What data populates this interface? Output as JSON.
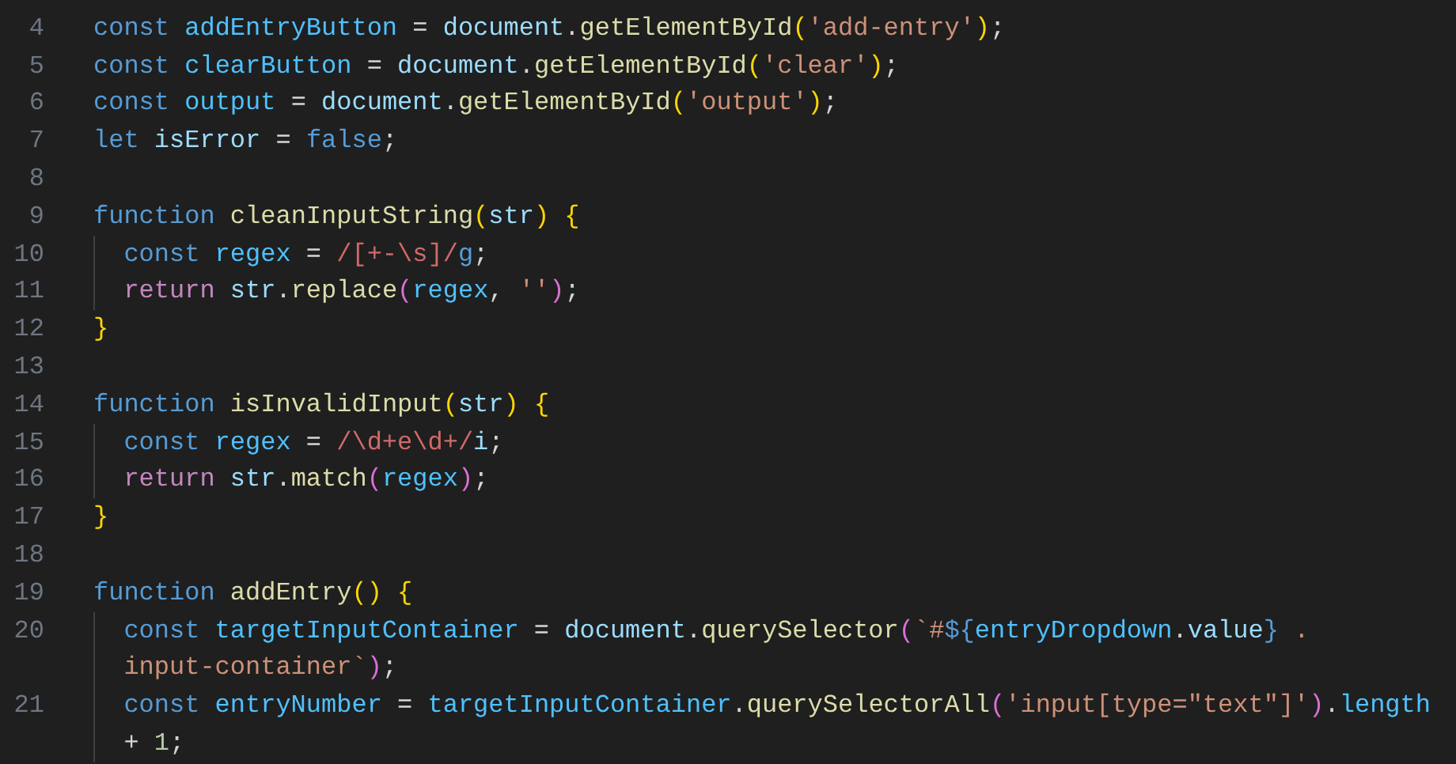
{
  "editor": {
    "lines": [
      {
        "number": "4",
        "rows": [
          {
            "indented": false,
            "tokens": [
              {
                "text": "const ",
                "kind": "keyword"
              },
              {
                "text": "addEntryButton",
                "kind": "constant"
              },
              {
                "text": " = ",
                "kind": "plain"
              },
              {
                "text": "document",
                "kind": "variable"
              },
              {
                "text": ".",
                "kind": "plain"
              },
              {
                "text": "getElementById",
                "kind": "function"
              },
              {
                "text": "(",
                "kind": "bracket1"
              },
              {
                "text": "'add-entry'",
                "kind": "string"
              },
              {
                "text": ")",
                "kind": "bracket1"
              },
              {
                "text": ";",
                "kind": "plain"
              }
            ]
          }
        ]
      },
      {
        "number": "5",
        "rows": [
          {
            "indented": false,
            "tokens": [
              {
                "text": "const ",
                "kind": "keyword"
              },
              {
                "text": "clearButton",
                "kind": "constant"
              },
              {
                "text": " = ",
                "kind": "plain"
              },
              {
                "text": "document",
                "kind": "variable"
              },
              {
                "text": ".",
                "kind": "plain"
              },
              {
                "text": "getElementById",
                "kind": "function"
              },
              {
                "text": "(",
                "kind": "bracket1"
              },
              {
                "text": "'clear'",
                "kind": "string"
              },
              {
                "text": ")",
                "kind": "bracket1"
              },
              {
                "text": ";",
                "kind": "plain"
              }
            ]
          }
        ]
      },
      {
        "number": "6",
        "rows": [
          {
            "indented": false,
            "tokens": [
              {
                "text": "const ",
                "kind": "keyword"
              },
              {
                "text": "output",
                "kind": "constant"
              },
              {
                "text": " = ",
                "kind": "plain"
              },
              {
                "text": "document",
                "kind": "variable"
              },
              {
                "text": ".",
                "kind": "plain"
              },
              {
                "text": "getElementById",
                "kind": "function"
              },
              {
                "text": "(",
                "kind": "bracket1"
              },
              {
                "text": "'output'",
                "kind": "string"
              },
              {
                "text": ")",
                "kind": "bracket1"
              },
              {
                "text": ";",
                "kind": "plain"
              }
            ]
          }
        ]
      },
      {
        "number": "7",
        "rows": [
          {
            "indented": false,
            "tokens": [
              {
                "text": "let ",
                "kind": "keyword"
              },
              {
                "text": "isError",
                "kind": "variable"
              },
              {
                "text": " = ",
                "kind": "plain"
              },
              {
                "text": "false",
                "kind": "keyword"
              },
              {
                "text": ";",
                "kind": "plain"
              }
            ]
          }
        ]
      },
      {
        "number": "8"
      },
      {
        "number": "9",
        "rows": [
          {
            "indented": false,
            "tokens": [
              {
                "text": "function ",
                "kind": "keyword"
              },
              {
                "text": "cleanInputString",
                "kind": "function"
              },
              {
                "text": "(",
                "kind": "bracket1"
              },
              {
                "text": "str",
                "kind": "variable"
              },
              {
                "text": ") ",
                "kind": "bracket1"
              },
              {
                "text": "{",
                "kind": "bracket1"
              }
            ]
          }
        ]
      },
      {
        "number": "10",
        "rows": [
          {
            "indented": true,
            "tokens": [
              {
                "text": "const ",
                "kind": "keyword"
              },
              {
                "text": "regex",
                "kind": "constant"
              },
              {
                "text": " = ",
                "kind": "plain"
              },
              {
                "text": "/[+-\\s]/",
                "kind": "regex"
              },
              {
                "text": "g",
                "kind": "keyword"
              },
              {
                "text": ";",
                "kind": "plain"
              }
            ]
          }
        ]
      },
      {
        "number": "11",
        "rows": [
          {
            "indented": true,
            "tokens": [
              {
                "text": "return ",
                "kind": "control"
              },
              {
                "text": "str",
                "kind": "variable"
              },
              {
                "text": ".",
                "kind": "plain"
              },
              {
                "text": "replace",
                "kind": "function"
              },
              {
                "text": "(",
                "kind": "bracket2"
              },
              {
                "text": "regex",
                "kind": "constant"
              },
              {
                "text": ", ",
                "kind": "plain"
              },
              {
                "text": "''",
                "kind": "string"
              },
              {
                "text": ")",
                "kind": "bracket2"
              },
              {
                "text": ";",
                "kind": "plain"
              }
            ]
          }
        ]
      },
      {
        "number": "12",
        "rows": [
          {
            "indented": false,
            "tokens": [
              {
                "text": "}",
                "kind": "bracket1"
              }
            ]
          }
        ]
      },
      {
        "number": "13"
      },
      {
        "number": "14",
        "rows": [
          {
            "indented": false,
            "tokens": [
              {
                "text": "function ",
                "kind": "keyword"
              },
              {
                "text": "isInvalidInput",
                "kind": "function"
              },
              {
                "text": "(",
                "kind": "bracket1"
              },
              {
                "text": "str",
                "kind": "variable"
              },
              {
                "text": ") ",
                "kind": "bracket1"
              },
              {
                "text": "{",
                "kind": "bracket1"
              }
            ]
          }
        ]
      },
      {
        "number": "15",
        "rows": [
          {
            "indented": true,
            "tokens": [
              {
                "text": "const ",
                "kind": "keyword"
              },
              {
                "text": "regex",
                "kind": "constant"
              },
              {
                "text": " = ",
                "kind": "plain"
              },
              {
                "text": "/\\d+e\\d+/",
                "kind": "regex"
              },
              {
                "text": "i",
                "kind": "variable"
              },
              {
                "text": ";",
                "kind": "plain"
              }
            ]
          }
        ]
      },
      {
        "number": "16",
        "rows": [
          {
            "indented": true,
            "tokens": [
              {
                "text": "return ",
                "kind": "control"
              },
              {
                "text": "str",
                "kind": "variable"
              },
              {
                "text": ".",
                "kind": "plain"
              },
              {
                "text": "match",
                "kind": "function"
              },
              {
                "text": "(",
                "kind": "bracket2"
              },
              {
                "text": "regex",
                "kind": "constant"
              },
              {
                "text": ")",
                "kind": "bracket2"
              },
              {
                "text": ";",
                "kind": "plain"
              }
            ]
          }
        ]
      },
      {
        "number": "17",
        "rows": [
          {
            "indented": false,
            "tokens": [
              {
                "text": "}",
                "kind": "bracket1"
              }
            ]
          }
        ]
      },
      {
        "number": "18"
      },
      {
        "number": "19",
        "rows": [
          {
            "indented": false,
            "tokens": [
              {
                "text": "function ",
                "kind": "keyword"
              },
              {
                "text": "addEntry",
                "kind": "function"
              },
              {
                "text": "() ",
                "kind": "bracket1"
              },
              {
                "text": "{",
                "kind": "bracket1"
              }
            ]
          }
        ]
      },
      {
        "number": "20",
        "rows": [
          {
            "indented": true,
            "tokens": [
              {
                "text": "const ",
                "kind": "keyword"
              },
              {
                "text": "targetInputContainer",
                "kind": "constant"
              },
              {
                "text": " = ",
                "kind": "plain"
              },
              {
                "text": "document",
                "kind": "variable"
              },
              {
                "text": ".",
                "kind": "plain"
              },
              {
                "text": "querySelector",
                "kind": "function"
              },
              {
                "text": "(",
                "kind": "bracket2"
              },
              {
                "text": "`#",
                "kind": "string"
              },
              {
                "text": "${",
                "kind": "keyword"
              },
              {
                "text": "entryDropdown",
                "kind": "constant"
              },
              {
                "text": ".",
                "kind": "plain"
              },
              {
                "text": "value",
                "kind": "variable"
              },
              {
                "text": "}",
                "kind": "keyword"
              },
              {
                "text": " .",
                "kind": "string"
              }
            ]
          },
          {
            "indented": true,
            "tokens": [
              {
                "text": "input-container`",
                "kind": "string"
              },
              {
                "text": ")",
                "kind": "bracket2"
              },
              {
                "text": ";",
                "kind": "plain"
              }
            ]
          }
        ]
      },
      {
        "number": "21",
        "rows": [
          {
            "indented": true,
            "tokens": [
              {
                "text": "const ",
                "kind": "keyword"
              },
              {
                "text": "entryNumber",
                "kind": "constant"
              },
              {
                "text": " = ",
                "kind": "plain"
              },
              {
                "text": "targetInputContainer",
                "kind": "constant"
              },
              {
                "text": ".",
                "kind": "plain"
              },
              {
                "text": "querySelectorAll",
                "kind": "function"
              },
              {
                "text": "(",
                "kind": "bracket2"
              },
              {
                "text": "'input[type=\"text\"]'",
                "kind": "string"
              },
              {
                "text": ")",
                "kind": "bracket2"
              },
              {
                "text": ".",
                "kind": "plain"
              },
              {
                "text": "length",
                "kind": "constant"
              }
            ]
          },
          {
            "indented": true,
            "tokens": [
              {
                "text": "+ ",
                "kind": "plain"
              },
              {
                "text": "1",
                "kind": "number"
              },
              {
                "text": ";",
                "kind": "plain"
              }
            ]
          }
        ]
      }
    ]
  }
}
